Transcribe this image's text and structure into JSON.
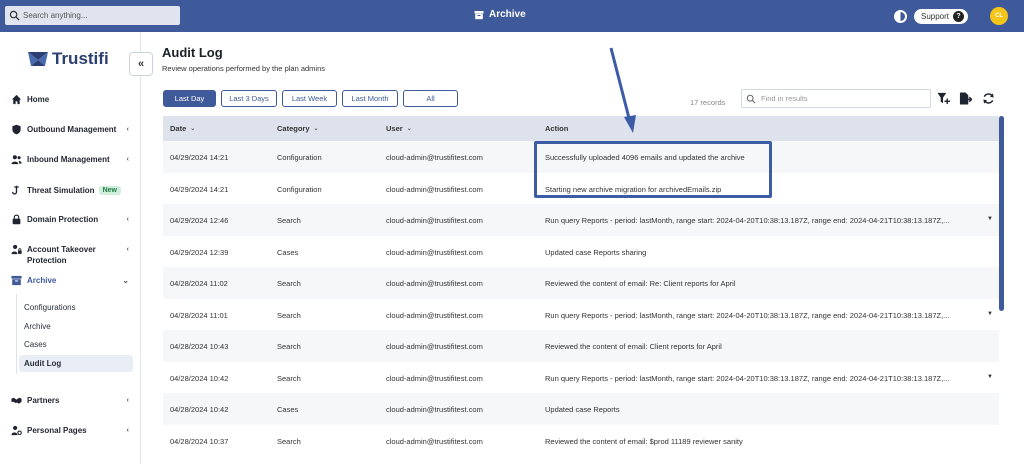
{
  "topbar": {
    "search_placeholder": "Search anything...",
    "title": "Archive",
    "support_label": "Support",
    "avatar_initials": "CL"
  },
  "brand": {
    "name": "Trustifi"
  },
  "sidebar": {
    "items": [
      {
        "label": "Home",
        "icon": "home-icon"
      },
      {
        "label": "Outbound Management",
        "icon": "shield-icon"
      },
      {
        "label": "Inbound Management",
        "icon": "users-icon"
      },
      {
        "label": "Threat Simulation",
        "icon": "hook-icon",
        "badge": "New"
      },
      {
        "label": "Domain Protection",
        "icon": "lock-icon"
      },
      {
        "label": "Account Takeover Protection",
        "icon": "user-lock-icon"
      },
      {
        "label": "Archive",
        "icon": "archive-icon"
      },
      {
        "label": "Partners",
        "icon": "handshake-icon"
      },
      {
        "label": "Personal Pages",
        "icon": "user-cog-icon"
      }
    ],
    "archive_sub": [
      "Configurations",
      "Archive",
      "Cases",
      "Audit Log"
    ]
  },
  "main": {
    "title": "Audit Log",
    "subtitle": "Review operations performed by the plan admins",
    "filters": [
      "Last Day",
      "Last 3 Days",
      "Last Week",
      "Last Month",
      "All"
    ],
    "records": "17 records",
    "find_placeholder": "Find in results",
    "columns": [
      "Date",
      "Category",
      "User",
      "Action"
    ],
    "rows": [
      {
        "date": "04/29/2024 14:21",
        "category": "Configuration",
        "user": "cloud-admin@trustifitest.com",
        "action": "Successfully uploaded 4096 emails and updated the archive"
      },
      {
        "date": "04/29/2024 14:21",
        "category": "Configuration",
        "user": "cloud-admin@trustifitest.com",
        "action": "Starting new archive migration for archivedEmails.zip"
      },
      {
        "date": "04/29/2024 12:46",
        "category": "Search",
        "user": "cloud-admin@trustifitest.com",
        "action": "Run query Reports - period: lastMonth, range start: 2024-04-20T10:38:13.187Z, range end: 2024-04-21T10:38:13.187Z,...",
        "expand": true
      },
      {
        "date": "04/29/2024 12:39",
        "category": "Cases",
        "user": "cloud-admin@trustifitest.com",
        "action": "Updated case Reports sharing"
      },
      {
        "date": "04/28/2024 11:02",
        "category": "Search",
        "user": "cloud-admin@trustifitest.com",
        "action": "Reviewed the content of email: Re: Client reports for April"
      },
      {
        "date": "04/28/2024 11:01",
        "category": "Search",
        "user": "cloud-admin@trustifitest.com",
        "action": "Run query Reports - period: lastMonth, range start: 2024-04-20T10:38:13.187Z, range end: 2024-04-21T10:38:13.187Z,...",
        "expand": true
      },
      {
        "date": "04/28/2024 10:43",
        "category": "Search",
        "user": "cloud-admin@trustifitest.com",
        "action": "Reviewed the content of email: Client reports for April"
      },
      {
        "date": "04/28/2024 10:42",
        "category": "Search",
        "user": "cloud-admin@trustifitest.com",
        "action": "Run query Reports - period: lastMonth, range start: 2024-04-20T10:38:13.187Z, range end: 2024-04-21T10:38:13.187Z,...",
        "expand": true
      },
      {
        "date": "04/28/2024 10:42",
        "category": "Cases",
        "user": "cloud-admin@trustifitest.com",
        "action": "Updated case Reports"
      },
      {
        "date": "04/28/2024 10:37",
        "category": "Search",
        "user": "cloud-admin@trustifitest.com",
        "action": "Reviewed the content of email: $prod 11189 reviewer sanity"
      }
    ]
  },
  "colors": {
    "accent": "#3f5a9a",
    "annotation": "#3c5da6",
    "new_badge": "#cfeedc"
  }
}
